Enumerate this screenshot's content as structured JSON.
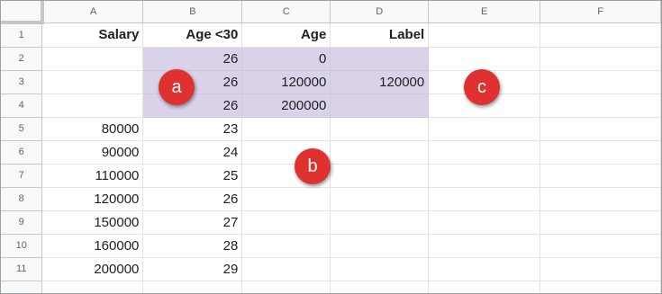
{
  "columns": [
    "A",
    "B",
    "C",
    "D",
    "E",
    "F"
  ],
  "rows": [
    {
      "num": "1",
      "cells": [
        "Salary",
        "Age <30",
        "Age",
        "Label",
        "",
        ""
      ]
    },
    {
      "num": "2",
      "cells": [
        "",
        "26",
        "0",
        "",
        "",
        ""
      ]
    },
    {
      "num": "3",
      "cells": [
        "",
        "26",
        "120000",
        "120000",
        "",
        ""
      ]
    },
    {
      "num": "4",
      "cells": [
        "",
        "26",
        "200000",
        "",
        "",
        ""
      ]
    },
    {
      "num": "5",
      "cells": [
        "80000",
        "23",
        "",
        "",
        "",
        ""
      ]
    },
    {
      "num": "6",
      "cells": [
        "90000",
        "24",
        "",
        "",
        "",
        ""
      ]
    },
    {
      "num": "7",
      "cells": [
        "110000",
        "25",
        "",
        "",
        "",
        ""
      ]
    },
    {
      "num": "8",
      "cells": [
        "120000",
        "26",
        "",
        "",
        "",
        ""
      ]
    },
    {
      "num": "9",
      "cells": [
        "150000",
        "27",
        "",
        "",
        "",
        ""
      ]
    },
    {
      "num": "10",
      "cells": [
        "160000",
        "28",
        "",
        "",
        "",
        ""
      ]
    },
    {
      "num": "11",
      "cells": [
        "200000",
        "29",
        "",
        "",
        "",
        ""
      ]
    }
  ],
  "callouts": [
    "a",
    "b",
    "c"
  ],
  "colors": {
    "highlight": "#d9d2e9",
    "callout": "#e03131",
    "header_bg": "#f8f9fa"
  }
}
